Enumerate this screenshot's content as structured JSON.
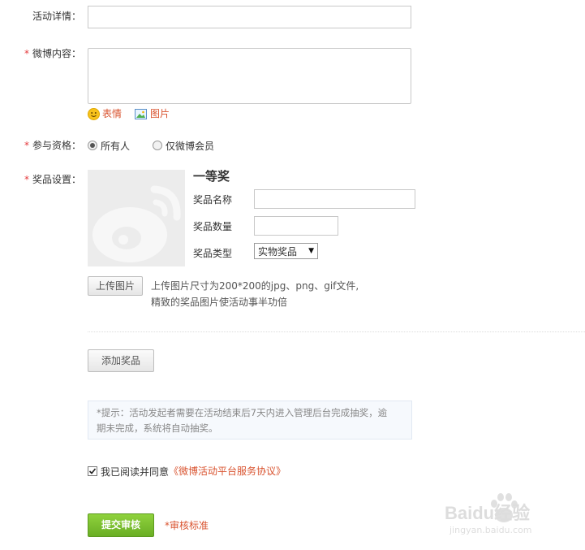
{
  "form": {
    "details_label": "活动详情：",
    "content_label": "微博内容：",
    "required_mark": "*",
    "emoji_label": "表情",
    "image_label": "图片",
    "eligibility_label": "参与资格：",
    "eligibility_options": [
      {
        "label": "所有人",
        "checked": true
      },
      {
        "label": "仅微博会员",
        "checked": false
      }
    ],
    "prize_label": "奖品设置："
  },
  "prize": {
    "title": "一等奖",
    "name_label": "奖品名称",
    "qty_label": "奖品数量",
    "type_label": "奖品类型",
    "type_value": "实物奖品",
    "upload_button": "上传图片",
    "upload_hint_1": "上传图片尺寸为200*200的jpg、png、gif文件,",
    "upload_hint_2": "精致的奖品图片使活动事半功倍"
  },
  "add_prize_button": "添加奖品",
  "notice": {
    "line1": "*提示：活动发起者需要在活动结束后7天内进入管理后台完成抽奖，逾",
    "line2": "期未完成，系统将自动抽奖。"
  },
  "agreement": {
    "checked": true,
    "prefix": "我已阅读并同意",
    "link": "《微博活动平台服务协议》"
  },
  "submit_button": "提交审核",
  "review_link": "*审核标准",
  "watermark": {
    "brand": "Baidu经验",
    "url": "jingyan.baidu.com"
  },
  "colors": {
    "accent": "#d9532f",
    "submit": "#7cbd2f"
  }
}
